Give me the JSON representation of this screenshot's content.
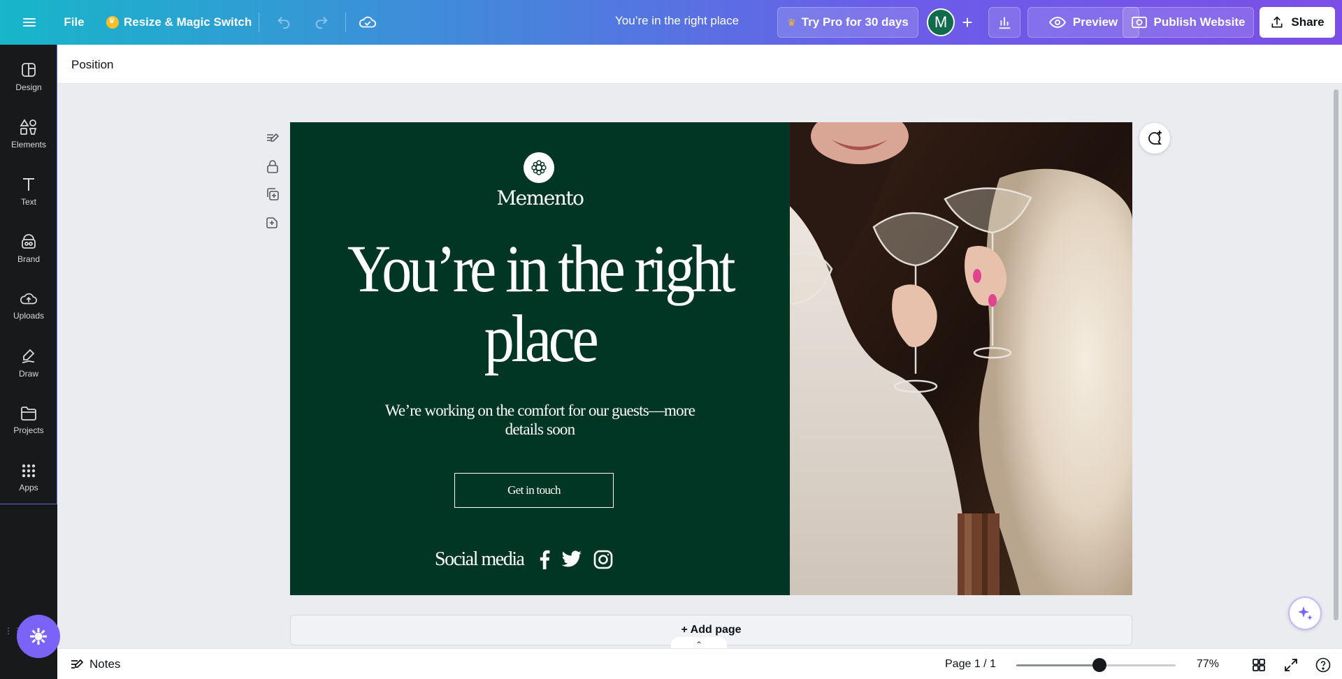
{
  "topbar": {
    "file_label": "File",
    "resize_label": "Resize & Magic Switch",
    "doc_title": "You’re in the right place",
    "pro_label": "Try Pro for 30 days",
    "avatar_initial": "M",
    "preview_label": "Preview",
    "publish_label": "Publish Website",
    "share_label": "Share"
  },
  "sidebar": {
    "items": [
      {
        "label": "Design",
        "icon": "design-icon"
      },
      {
        "label": "Elements",
        "icon": "elements-icon"
      },
      {
        "label": "Text",
        "icon": "text-icon"
      },
      {
        "label": "Brand",
        "icon": "brand-icon"
      },
      {
        "label": "Uploads",
        "icon": "uploads-icon"
      },
      {
        "label": "Draw",
        "icon": "draw-icon"
      },
      {
        "label": "Projects",
        "icon": "projects-icon"
      },
      {
        "label": "Apps",
        "icon": "apps-icon"
      }
    ]
  },
  "context_toolbar": {
    "position_label": "Position"
  },
  "design": {
    "logo_text": "Memento",
    "headline": "You’re in the right place",
    "subtext": "We’re working on the comfort for our guests—more details soon",
    "cta_label": "Get in touch",
    "social_label": "Social media",
    "social_icons": [
      "facebook-icon",
      "twitter-icon",
      "instagram-icon"
    ],
    "bg_color": "#023624"
  },
  "canvas": {
    "add_page_label": "+ Add page"
  },
  "bottombar": {
    "notes_label": "Notes",
    "page_label": "Page 1 / 1",
    "zoom_label": "77%",
    "zoom_fraction": 0.52
  },
  "colors": {
    "topbar_start": "#17b6c9",
    "topbar_end": "#7b4fe6",
    "rail_bg": "#18191b",
    "accent": "#7a63f6"
  }
}
